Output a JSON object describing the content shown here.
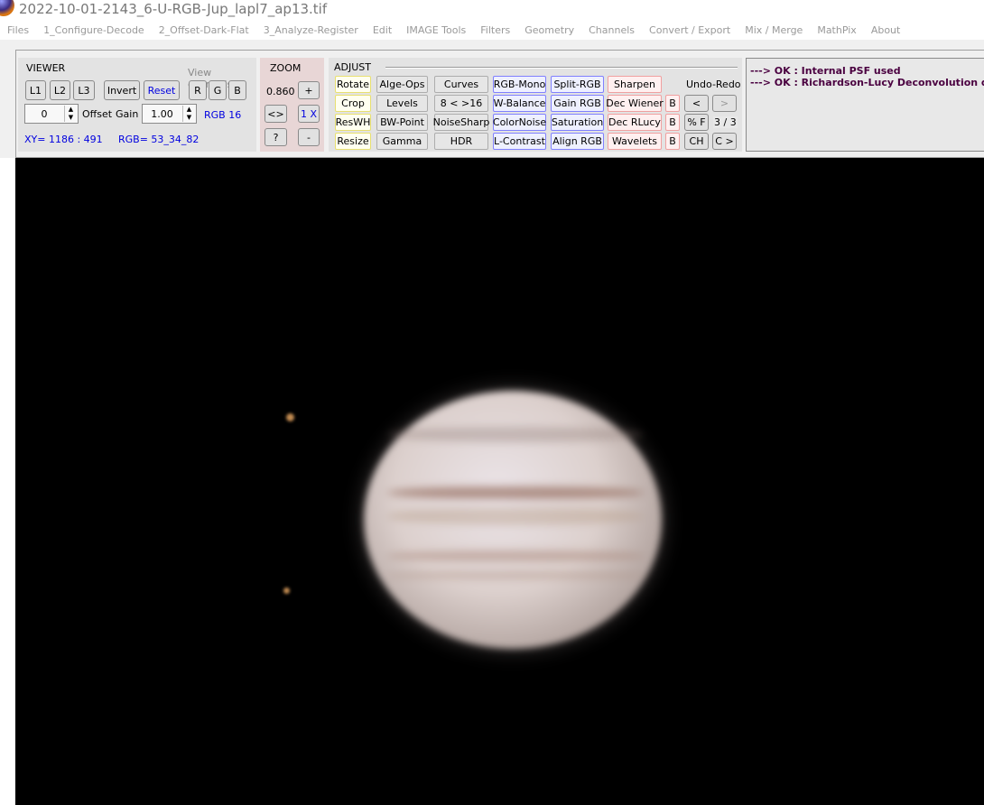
{
  "window": {
    "title": "2022-10-01-2143_6-U-RGB-Jup_lapl7_ap13.tif"
  },
  "menu": [
    "Files",
    "1_Configure-Decode",
    "2_Offset-Dark-Flat",
    "3_Analyze-Register",
    "Edit",
    "IMAGE Tools",
    "Filters",
    "Geometry",
    "Channels",
    "Convert / Export",
    "Mix / Merge",
    "MathPix",
    "About"
  ],
  "viewer": {
    "label": "VIEWER",
    "view_channels_label": "View channels",
    "layer_buttons": [
      "L1",
      "L2",
      "L3"
    ],
    "invert": "Invert",
    "reset": "Reset",
    "channel_buttons": [
      "R",
      "G",
      "B"
    ],
    "offset_value": "0",
    "offset_label": "Offset",
    "gain_label": "Gain",
    "gain_value": "1.00",
    "bit_depth": "RGB 16",
    "xy": "XY=  1186 : 491",
    "rgb": "RGB=  53_34_82"
  },
  "zoom": {
    "label": "ZOOM",
    "value": "0.860",
    "plus": "+",
    "fit": "<>",
    "one_x": "1 X",
    "help": "?",
    "minus": "-"
  },
  "adjust": {
    "label": "ADJUST",
    "undo_redo_label": "Undo-Redo",
    "undo_count": "3 / 3",
    "buttons": [
      [
        "Rotate",
        "Alge-Ops",
        "Curves",
        "RGB-Mono",
        "Split-RGB",
        "Sharpen"
      ],
      [
        "Crop",
        "Levels",
        "8 < >16",
        "W-Balance",
        "Gain RGB",
        "Dec Wiener",
        "B",
        "<",
        ">"
      ],
      [
        "ResWH",
        "BW-Point",
        "NoiseSharp",
        "ColorNoise",
        "Saturation",
        "Dec RLucy",
        "B",
        "% F"
      ],
      [
        "Resize",
        "Gamma",
        "HDR",
        "L-Contrast",
        "Align RGB",
        "Wavelets",
        "B",
        "CH",
        "C >"
      ]
    ]
  },
  "log": [
    "---> OK :  Internal PSF used",
    "---> OK :  Richardson-Lucy Deconvolution done"
  ],
  "colors": {
    "log_text": "#4a0040",
    "info_text": "#0000e0",
    "image_bg": "#000000"
  }
}
